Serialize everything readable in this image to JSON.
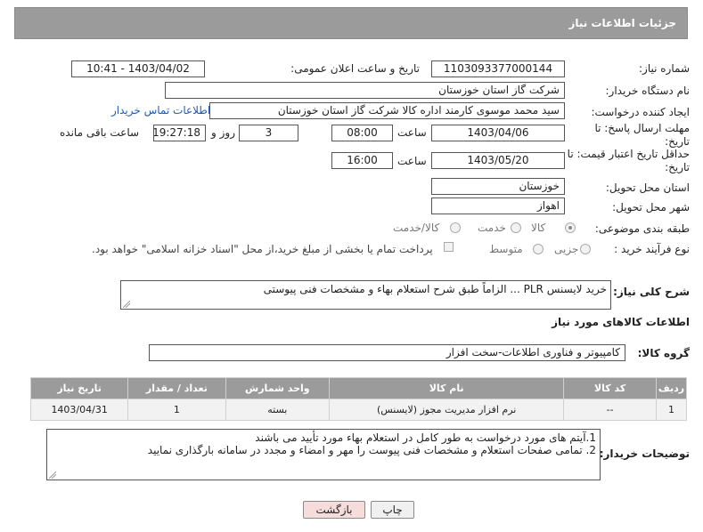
{
  "panel_title": "جزئیات اطلاعات نیاز",
  "fields": {
    "need_number": {
      "label": "شماره نیاز:",
      "value": "1103093377000144"
    },
    "announce_datetime": {
      "label": "تاریخ و ساعت اعلان عمومی:",
      "value": "1403/04/02 - 10:41"
    },
    "buyer_org": {
      "label": "نام دستگاه خریدار:",
      "value": "شرکت گاز استان خوزستان"
    },
    "requester": {
      "label": "ایجاد کننده درخواست:",
      "value": "سید محمد موسوی کارمند اداره کالا شرکت گاز استان خوزستان",
      "link": "اطلاعات تماس خریدار"
    },
    "reply_deadline": {
      "label": "مهلت ارسال پاسخ: تا تاریخ:",
      "date": "1403/04/06",
      "time_label": "ساعت",
      "time": "08:00",
      "days": "3",
      "days_label": "روز و",
      "remaining": "19:27:18",
      "remaining_label": "ساعت باقی مانده"
    },
    "price_validity": {
      "label": "حداقل تاریخ اعتبار قیمت: تا تاریخ:",
      "date": "1403/05/20",
      "time_label": "ساعت",
      "time": "16:00"
    },
    "province": {
      "label": "استان محل تحویل:",
      "value": "خوزستان"
    },
    "city": {
      "label": "شهر محل تحویل:",
      "value": "اهواز"
    },
    "category": {
      "label": "طبقه بندی موضوعی:",
      "options": [
        "کالا",
        "خدمت",
        "کالا/خدمت"
      ]
    },
    "process": {
      "label": "نوع فرآیند خرید :",
      "options": [
        "جزیی",
        "متوسط"
      ],
      "note": "پرداخت تمام یا بخشی از مبلغ خرید،از محل \"اسناد خزانه اسلامی\" خواهد بود."
    }
  },
  "description": {
    "label": "شرح کلی نیاز:",
    "value": "خرید لایسنس PLR ... الزاماً طبق شرح استعلام بهاء و مشخصات فنی پیوستی"
  },
  "goods_section_title": "اطلاعات کالاهای مورد نیاز",
  "goods_group": {
    "label": "گروه کالا:",
    "value": "کامپیوتر و فناوری اطلاعات-سخت افزار"
  },
  "table": {
    "headers": [
      "ردیف",
      "کد کالا",
      "نام کالا",
      "واحد شمارش",
      "تعداد / مقدار",
      "تاریخ نیاز"
    ],
    "rows": [
      [
        "1",
        "--",
        "نرم افزار مدیریت مجوز (لایسنس)",
        "بسته",
        "1",
        "1403/04/31"
      ]
    ]
  },
  "buyer_notes": {
    "label": "توضیحات خریدار:",
    "lines": [
      "1.آیتم های مورد درخواست به طور کامل در استعلام بهاء مورد تأیید می باشند",
      "2. تمامی صفحات استعلام و مشخصات فنی پیوست را مهر و امضاء و مجدد در سامانه بارگذاری نمایید"
    ]
  },
  "buttons": {
    "print": "چاپ",
    "back": "بازگشت"
  }
}
